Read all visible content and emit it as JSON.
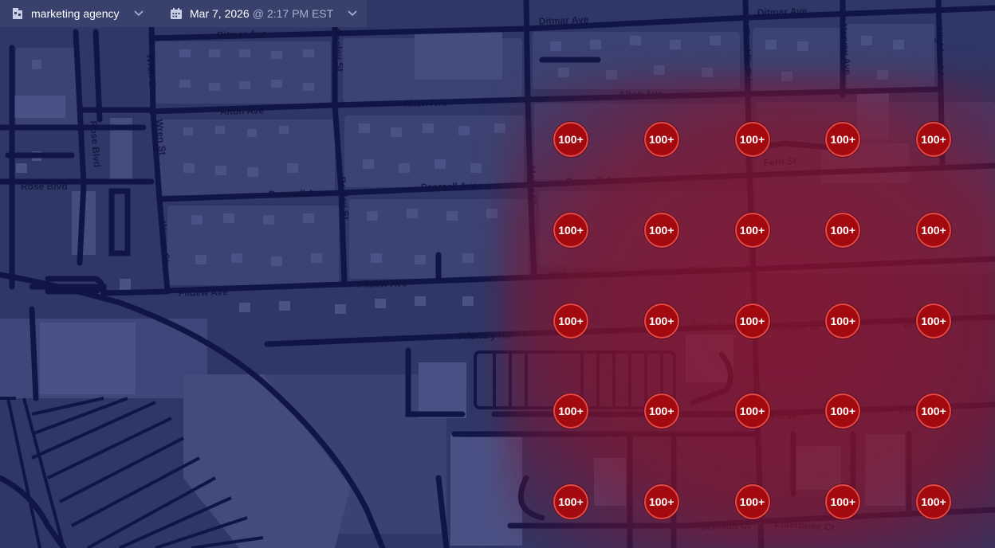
{
  "toolbar": {
    "business_name": "marketing agency",
    "business_icon": "business-icon",
    "date": "Mar 7, 2026",
    "at_symbol": "@",
    "time": "2:17 PM EST",
    "calendar_icon": "calendar-icon",
    "chevron_icon": "chevron-down-icon"
  },
  "streets": {
    "ditmar_1": "Ditmar Ave",
    "ditmar_2": "Ditmar Ave",
    "ditmar_3": "Ditmar Ave",
    "alton_1": "Alton Ave",
    "alton_2": "Alton Ave",
    "alton_3": "Alton Ave",
    "pearsall_1": "Pearsall Ave",
    "pearsall_2": "Pearsall Ave",
    "pearsall_3": "Pearsall Ave",
    "fildew_1": "Fildew Ave",
    "fildew_2": "Fildew Ave",
    "fildew_3": "Fildew Ave",
    "fildew_4": "Fildew Ave",
    "friendly_1": "Friendly Rd",
    "friendly_2": "Friendly",
    "friendly_3": "Fr",
    "fremont": "Fremont St",
    "fern": "Fern St",
    "furse_1": "Furse",
    "furse_2": "Fu",
    "denison": "Denison Ct",
    "enterprise": "Enterprise Ct",
    "rose_blvd_v": "Rose Blvd",
    "rose_blvd_h": "Rose Blvd",
    "wren_1": "Wren St",
    "wren_2": "Wren St",
    "wren_3": "Wrenn St",
    "bagley_1": "Bagley St",
    "bagley_2": "Bagley St",
    "motor": "Motor St",
    "franklin_1": "Franklin Rd",
    "franklin_2": "Franklin Rd",
    "harvey": "Harvey Ave",
    "highland": "Highland Ave",
    "f_edge": "F"
  },
  "grid": {
    "rows": 5,
    "cols": 5,
    "values": [
      [
        "100+",
        "100+",
        "100+",
        "100+",
        "100+"
      ],
      [
        "100+",
        "100+",
        "100+",
        "100+",
        "100+"
      ],
      [
        "100+",
        "100+",
        "100+",
        "100+",
        "100+"
      ],
      [
        "100+",
        "100+",
        "100+",
        "100+",
        "100+"
      ],
      [
        "100+",
        "100+",
        "100+",
        "100+",
        "100+"
      ]
    ]
  },
  "colors": {
    "map_background": "#2f3766",
    "road": "#0f1646",
    "block": "#3a4272",
    "pin_fill": "#a30a0f",
    "pin_border": "#e04a48",
    "heat": "#8c122a"
  }
}
